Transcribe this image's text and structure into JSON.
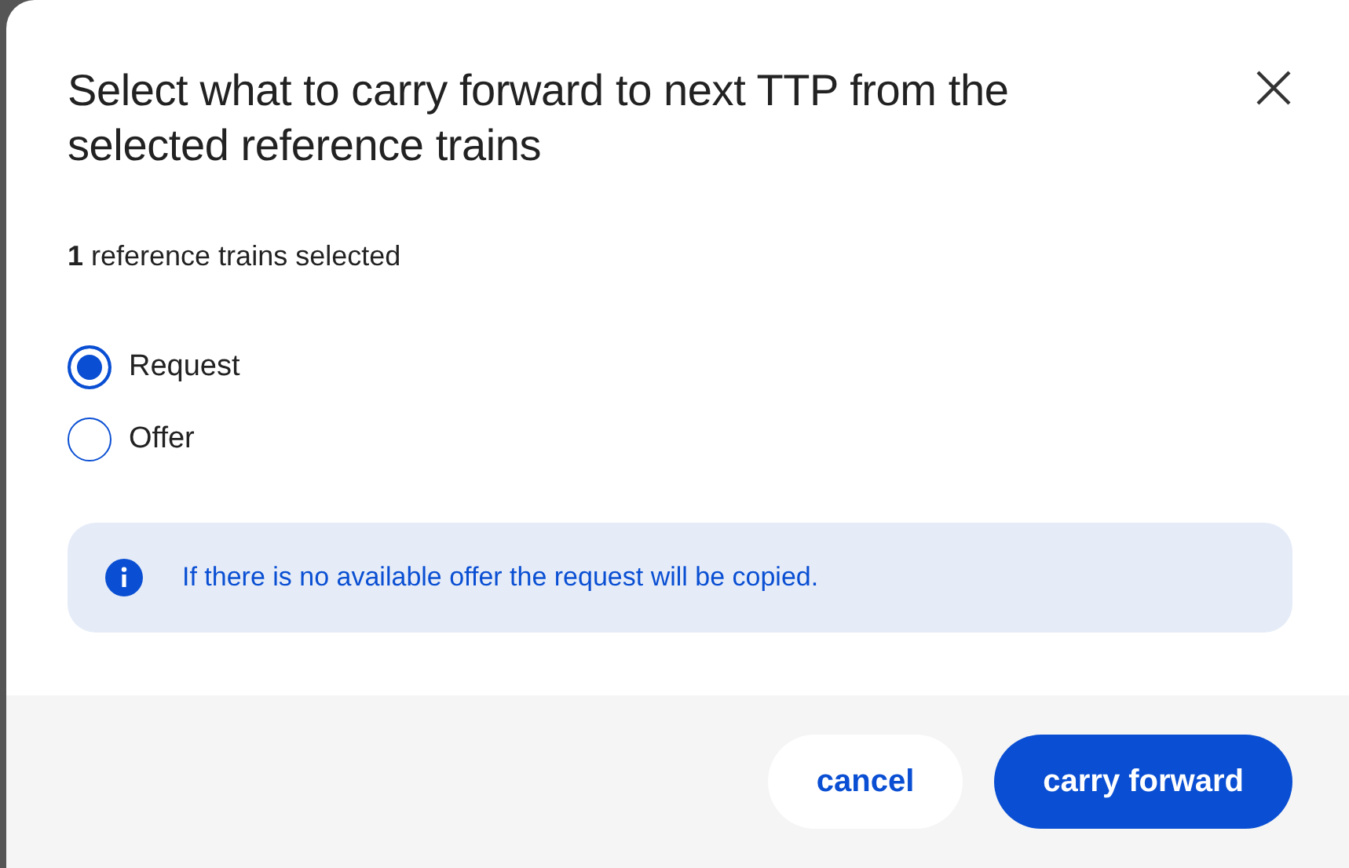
{
  "dialog": {
    "title": "Select what to carry forward to next TTP from the selected reference trains",
    "selection_summary": "**1** reference trains selected",
    "options": [
      {
        "label": "Request",
        "selected": true
      },
      {
        "label": "Offer",
        "selected": false
      }
    ],
    "info": "If there is no available offer the request will be copied.",
    "buttons": [
      {
        "label": "cancel",
        "kind": "secondary"
      },
      {
        "label": "carry forward",
        "kind": "primary"
      }
    ]
  }
}
